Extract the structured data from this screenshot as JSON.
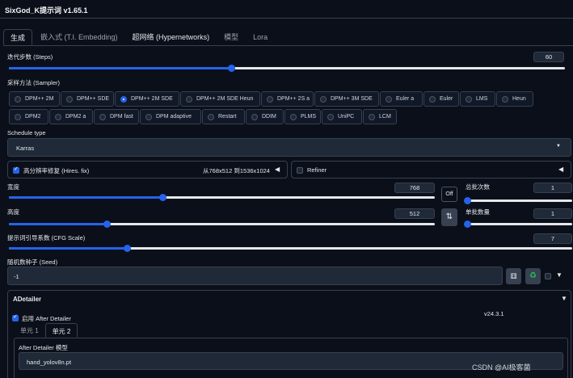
{
  "app": {
    "title": "SixGod_K提示词 v1.65.1"
  },
  "tabs": [
    "生成",
    "嵌入式 (T.I. Embedding)",
    "超网络 (Hypernetworks)",
    "模型",
    "Lora"
  ],
  "steps": {
    "label": "迭代步数 (Steps)",
    "value": "60",
    "fraction": 0.4
  },
  "sampler": {
    "label": "采样方法 (Sampler)",
    "selected": "DPM++ 2M SDE",
    "options_row1": [
      "DPM++ 2M",
      "DPM++ SDE",
      "DPM++ 2M SDE",
      "DPM++ 2M SDE Heun",
      "DPM++ 2S a",
      "DPM++ 3M SDE",
      "Euler a",
      "Euler",
      "LMS",
      "Heun"
    ],
    "options_row2": [
      "DPM2",
      "DPM2 a",
      "DPM fast",
      "DPM adaptive",
      "Restart",
      "DDIM",
      "PLMS",
      "UniPC",
      "LCM"
    ]
  },
  "schedule": {
    "label": "Schedule type",
    "value": "Karras"
  },
  "hires": {
    "label": "高分辨率修复 (Hires. fix)",
    "info": "从768x512 到1536x1024",
    "checked": true
  },
  "refiner": {
    "label": "Refiner",
    "checked": false
  },
  "width": {
    "label": "宽度",
    "value": "768",
    "fraction": 0.36
  },
  "height": {
    "label": "高度",
    "value": "512",
    "fraction": 0.23
  },
  "off_button": "Off",
  "swap_icon": "swap-vertical-icon",
  "batch_count": {
    "label": "总批次数",
    "value": "1",
    "fraction": 0.0
  },
  "batch_size": {
    "label": "单批数量",
    "value": "1",
    "fraction": 0.0
  },
  "cfg": {
    "label": "提示词引导系数 (CFG Scale)",
    "value": "7",
    "fraction": 0.21
  },
  "seed": {
    "label": "随机数种子 (Seed)",
    "value": "-1"
  },
  "adetailer": {
    "title": "ADetailer",
    "enable_label": "启用 After Detailer",
    "version": "v24.3.1",
    "tabs": [
      "单元 1",
      "单元 2"
    ],
    "model_label": "After Detailer 模型",
    "model_value": "hand_yolov8n.pt"
  },
  "watermark": "CSDN @AI极客菌",
  "colors": {
    "accent": "#2563eb",
    "background": "#0b0f19",
    "panel": "#1f2937",
    "border": "#374151"
  }
}
